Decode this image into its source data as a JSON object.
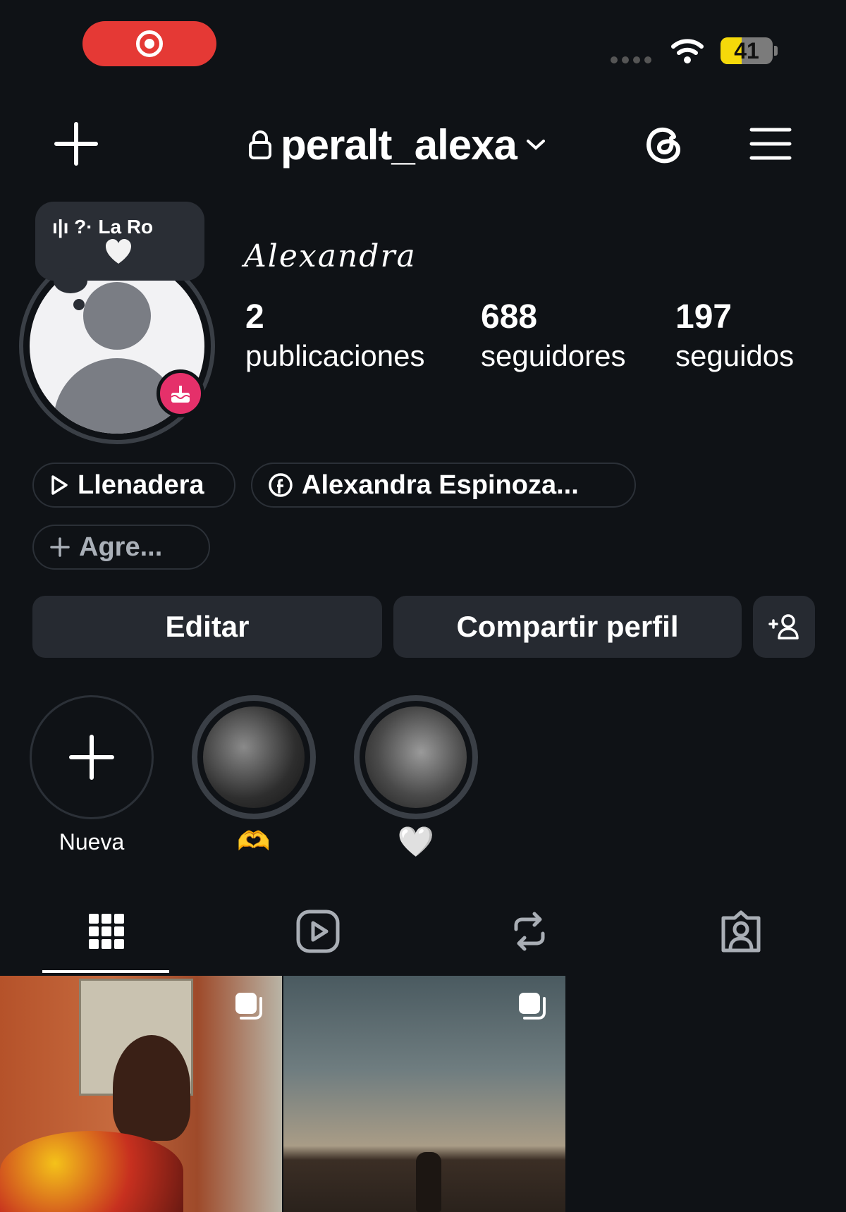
{
  "status_bar": {
    "battery": "41"
  },
  "header": {
    "username": "peralt_alexa"
  },
  "profile": {
    "note_text": "ı|ı ?· La Ro",
    "display_name": "Alexandra",
    "stats": [
      {
        "value": "2",
        "label": "publicaciones"
      },
      {
        "value": "688",
        "label": "seguidores"
      },
      {
        "value": "197",
        "label": "seguidos"
      }
    ]
  },
  "links": {
    "playlist": "Llenadera",
    "facebook": "Alexandra Espinoza...",
    "add": "Agre..."
  },
  "actions": {
    "edit": "Editar",
    "share": "Compartir perfil"
  },
  "highlights": [
    {
      "label": "Nueva"
    },
    {
      "label": "🫶"
    },
    {
      "label": "🤍"
    }
  ],
  "colors": {
    "background": "#0f1216",
    "button": "#262a31",
    "record": "#e53935",
    "battery": "#f5d90a",
    "birthday": "#e5306a"
  }
}
